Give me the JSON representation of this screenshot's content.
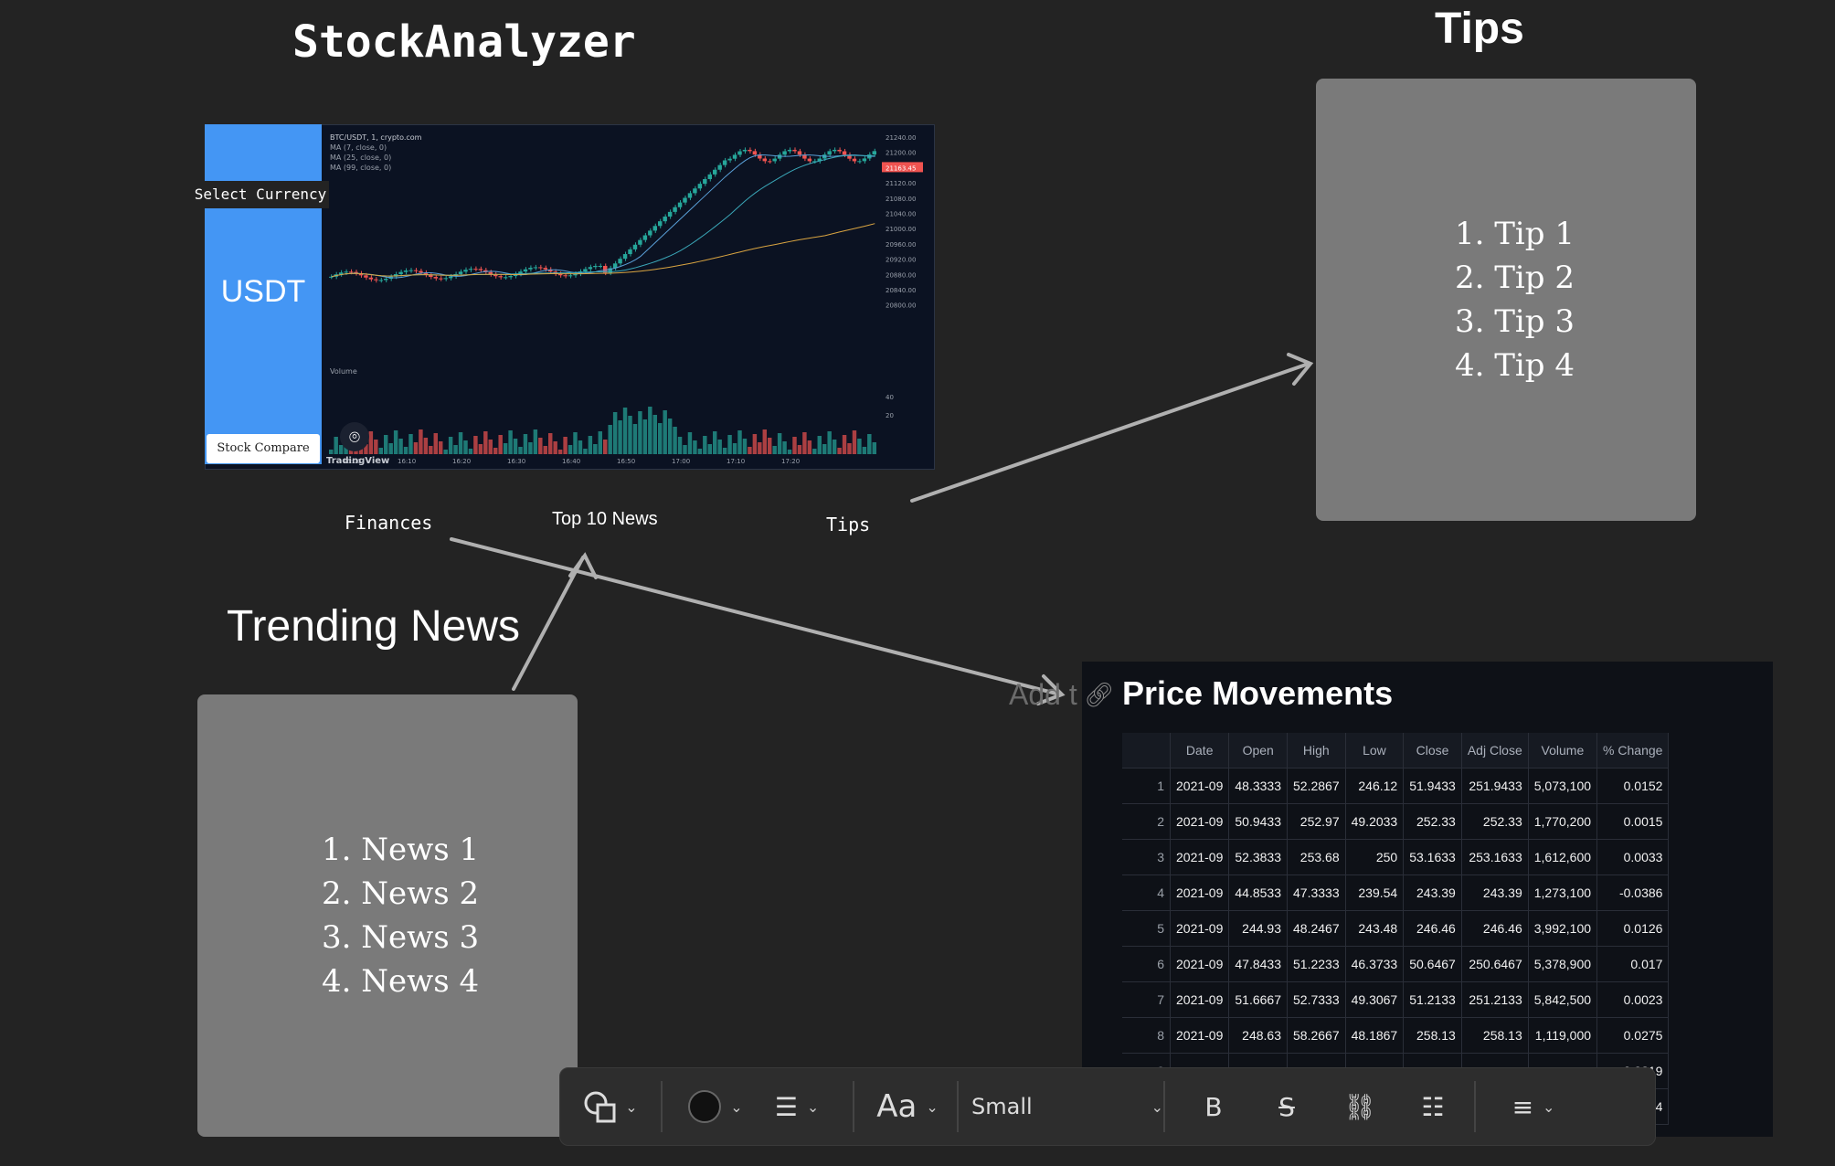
{
  "app_title": "StockAnalyzer",
  "tips_title": "Tips",
  "trending_title": "Trending News",
  "currency": {
    "select_label": "Select Currency",
    "value": "USDT",
    "compare_button": "Stock Compare"
  },
  "chart": {
    "symbol": "BTC/USDT, 1, crypto.com",
    "ma_lines": [
      "MA (7, close, 0)",
      "MA (25, close, 0)",
      "MA (99, close, 0)"
    ],
    "price_ticks": [
      "21240.00",
      "21200.00",
      "21163.45",
      "21120.00",
      "21080.00",
      "21040.00",
      "21000.00",
      "20960.00",
      "20920.00",
      "20880.00",
      "20840.00",
      "20800.00"
    ],
    "last_price": "21163.45",
    "volume_label": "Volume",
    "volume_ticks": [
      "40",
      "20"
    ],
    "time_ticks": [
      "16:00",
      "16:10",
      "16:20",
      "16:30",
      "16:40",
      "16:50",
      "17:00",
      "17:10",
      "17:20"
    ],
    "brand": "TradingView",
    "colors": {
      "up": "#26a69a",
      "down": "#ef5350",
      "ma7": "#5aa0d8",
      "ma25": "#3aa7b8",
      "ma99": "#d9a441",
      "bg": "#0b1222"
    }
  },
  "nav": {
    "finances": "Finances",
    "top_news": "Top 10 News",
    "tips": "Tips"
  },
  "tips": [
    "1. Tip 1",
    "2. Tip 2",
    "3. Tip 3",
    "4. Tip 4"
  ],
  "news": [
    "1. News 1",
    "2. News 2",
    "3. News 3",
    "4. News 4"
  ],
  "price_movements": {
    "title": "Price Movements",
    "ghost_text": "Add t",
    "headers": [
      "",
      "Date",
      "Open",
      "High",
      "Low",
      "Close",
      "Adj Close",
      "Volume",
      "% Change"
    ],
    "rows": [
      [
        "1",
        "2021-09",
        "48.3333",
        "52.2867",
        "246.12",
        "51.9433",
        "251.9433",
        "5,073,100",
        "0.0152"
      ],
      [
        "2",
        "2021-09",
        "50.9433",
        "252.97",
        "49.2033",
        "252.33",
        "252.33",
        "1,770,200",
        "0.0015"
      ],
      [
        "3",
        "2021-09",
        "52.3833",
        "253.68",
        "250",
        "53.1633",
        "253.1633",
        "1,612,600",
        "0.0033"
      ],
      [
        "4",
        "2021-09",
        "44.8533",
        "47.3333",
        "239.54",
        "243.39",
        "243.39",
        "1,273,100",
        "-0.0386"
      ],
      [
        "5",
        "2021-09",
        "244.93",
        "48.2467",
        "243.48",
        "246.46",
        "246.46",
        "3,992,100",
        "0.0126"
      ],
      [
        "6",
        "2021-09",
        "47.8433",
        "51.2233",
        "46.3733",
        "50.6467",
        "250.6467",
        "5,378,900",
        "0.017"
      ],
      [
        "7",
        "2021-09",
        "51.6667",
        "52.7333",
        "49.3067",
        "51.2133",
        "251.2133",
        "5,842,500",
        "0.0023"
      ],
      [
        "8",
        "2021-09",
        "248.63",
        "58.2667",
        "48.1867",
        "258.13",
        "258.13",
        "1,119,000",
        "0.0275"
      ],
      [
        "9",
        "",
        "",
        "",
        "",
        "",
        "",
        "",
        "0.0219"
      ],
      [
        "10",
        "",
        "",
        "",
        "",
        "",
        "",
        "",
        "-0.0174"
      ]
    ]
  },
  "toolbar": {
    "font_size": "Small",
    "font_label": "Aa",
    "bold": "B",
    "strike": "S"
  }
}
